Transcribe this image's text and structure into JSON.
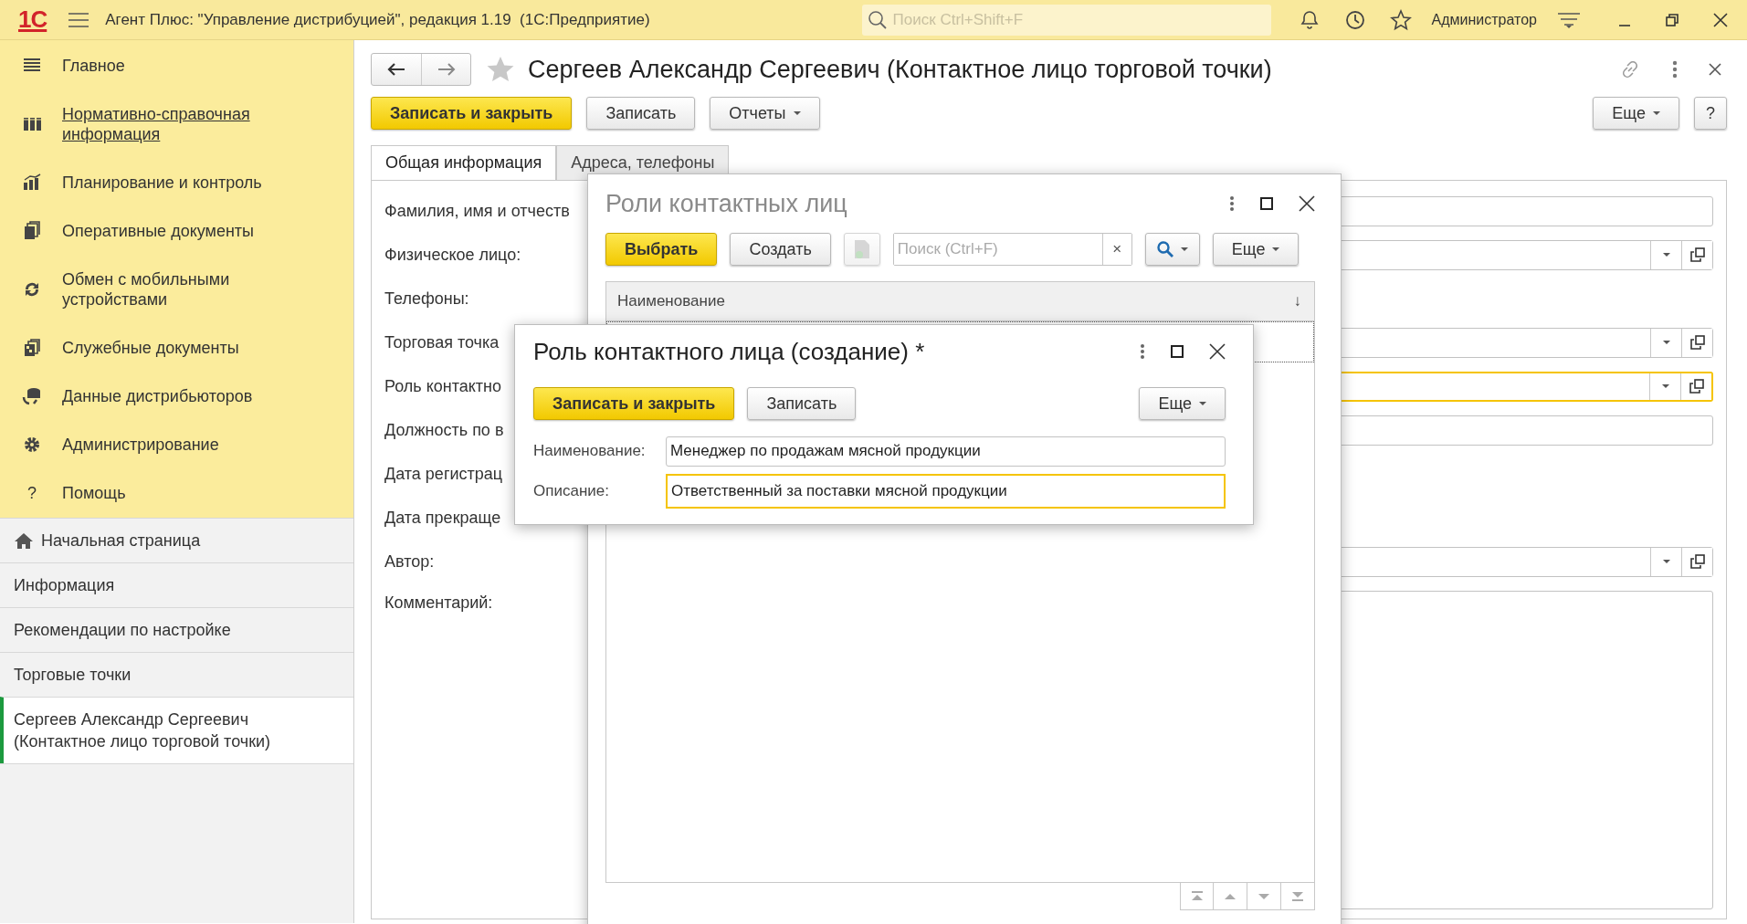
{
  "app": {
    "logo": "1С",
    "title": "Агент Плюс: \"Управление дистрибуцией\", редакция 1.19  (1С:Предприятие)",
    "search_placeholder": "Поиск Ctrl+Shift+F",
    "user": "Администратор"
  },
  "sections": [
    {
      "label": "Главное",
      "kind": "menu",
      "underlined": false
    },
    {
      "label": "Нормативно-справочная информация",
      "kind": "catalog",
      "underlined": true
    },
    {
      "label": "Планирование и контроль",
      "kind": "chart",
      "underlined": false
    },
    {
      "label": "Оперативные документы",
      "kind": "docs",
      "underlined": false
    },
    {
      "label": "Обмен с мобильными устройствами",
      "kind": "sync",
      "underlined": false
    },
    {
      "label": "Служебные документы",
      "kind": "service",
      "underlined": false
    },
    {
      "label": "Данные дистрибьюторов",
      "kind": "distrib",
      "underlined": false
    },
    {
      "label": "Администрирование",
      "kind": "gear",
      "underlined": false
    },
    {
      "label": "Помощь",
      "kind": "help",
      "glyph": "?",
      "underlined": false
    }
  ],
  "open_pages": [
    {
      "label": "Начальная страница",
      "kind": "home",
      "selected": false
    },
    {
      "label": "Информация",
      "kind": "page",
      "selected": false
    },
    {
      "label": "Рекомендации по настройке",
      "kind": "page",
      "selected": false
    },
    {
      "label": "Торговые точки",
      "kind": "page",
      "selected": false
    },
    {
      "label": "Сергеев Александр Сергеевич (Контактное лицо торговой точки)",
      "kind": "page",
      "selected": true
    }
  ],
  "form": {
    "title": "Сергеев Александр Сергеевич (Контактное лицо торговой точки)",
    "bookmarked": false,
    "buttons": [
      {
        "label": "Записать и закрыть",
        "kind": "primary"
      },
      {
        "label": "Записать",
        "kind": "plain"
      },
      {
        "label": "Отчеты",
        "kind": "menu"
      }
    ],
    "right_buttons": [
      {
        "label": "Еще",
        "kind": "menu"
      },
      {
        "label": "?",
        "kind": "plain"
      }
    ],
    "tabs": [
      {
        "label": "Общая информация",
        "selected": true
      },
      {
        "label": "Адреса, телефоны",
        "selected": false
      }
    ],
    "fields": [
      {
        "label": "Фамилия, имя и отчеств",
        "kind": "text",
        "focused": false
      },
      {
        "label": "Физическое лицо:",
        "kind": "select",
        "focused": false
      },
      {
        "label": "Телефоны:",
        "kind": "label"
      },
      {
        "label": "Торговая точка",
        "kind": "select",
        "focused": false
      },
      {
        "label": "Роль контактно",
        "kind": "select",
        "focused": true
      },
      {
        "label": "Должность по в",
        "kind": "text",
        "focused": false
      },
      {
        "label": "Дата регистрац",
        "kind": "label"
      },
      {
        "label": "Дата прекраще",
        "kind": "label"
      },
      {
        "label": "Автор:",
        "kind": "select",
        "focused": false
      },
      {
        "label": "Комментарий:",
        "kind": "textarea",
        "focused": false
      }
    ]
  },
  "roles_dialog": {
    "title": "Роли контактных лиц",
    "buttons": [
      {
        "label": "Выбрать",
        "kind": "primary"
      },
      {
        "label": "Создать",
        "kind": "plain"
      }
    ],
    "search_placeholder": "Поиск (Ctrl+F)",
    "clear_mark": "×",
    "more_button": "Еще",
    "column": "Наименование",
    "sort_mark": "↓"
  },
  "role_dialog": {
    "title": "Роль контактного лица (создание) *",
    "buttons": [
      {
        "label": "Записать и закрыть",
        "kind": "primary"
      },
      {
        "label": "Записать",
        "kind": "plain"
      }
    ],
    "more_button": "Еще",
    "fields": [
      {
        "label": "Наименование:",
        "value": "Менеджер по продажам мясной продукции",
        "focused": false
      },
      {
        "label": "Описание:",
        "value": "Ответственный за поставки мясной продукции",
        "focused": true
      }
    ]
  }
}
